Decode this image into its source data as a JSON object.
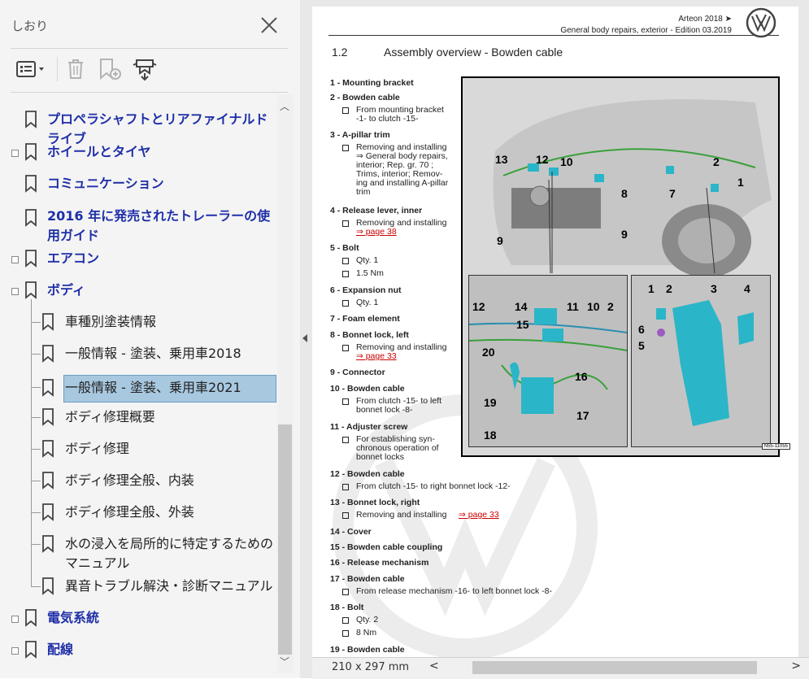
{
  "sidebar": {
    "title": "しおり",
    "toolbar": {
      "options_icon": "list-options-icon",
      "delete_icon": "trash-icon",
      "new_bookmark_icon": "new-bookmark-icon",
      "expand_icon": "expand-bookmark-icon"
    },
    "items": [
      {
        "label": "プロペラシャフトとリアファイナルドライブ"
      },
      {
        "label": "ホイールとタイヤ"
      },
      {
        "label": "コミュニケーション"
      },
      {
        "label": "2016 年に発売されたトレーラーの使用ガイド"
      },
      {
        "label": "エアコン"
      },
      {
        "label": "ボディ"
      },
      {
        "label": "車種別塗装情報"
      },
      {
        "label": "一般情報 - 塗装、乗用車2018"
      },
      {
        "label": "一般情報 - 塗装、乗用車2021"
      },
      {
        "label": "ボディ修理概要"
      },
      {
        "label": "ボディ修理"
      },
      {
        "label": "ボディ修理全般、内装"
      },
      {
        "label": "ボディ修理全般、外装"
      },
      {
        "label": "水の浸入を局所的に特定するためのマニュアル"
      },
      {
        "label": "異音トラブル解決・診断マニュアル"
      },
      {
        "label": "電気系統"
      },
      {
        "label": "配線"
      }
    ]
  },
  "document": {
    "header_model": "Arteon 2018 ➤",
    "header_edition": "General body repairs, exterior - Edition 03.2019",
    "section_number": "1.2",
    "section_title": "Assembly overview - Bowden cable",
    "entries": [
      {
        "title": "1 - Mounting bracket",
        "subs": []
      },
      {
        "title": "2 - Bowden cable",
        "subs": [
          "From mounting bracket",
          "-1- to clutch -15-"
        ]
      },
      {
        "title": "3 - A-pillar trim",
        "subs": [
          "Removing and installing",
          "⇒ General body repairs,",
          "interior; Rep. gr.  70 ;",
          "Trims, interior; Remov-",
          "ing and installing A-pillar",
          "trim"
        ]
      },
      {
        "title": "4 - Release lever, inner",
        "subs": [
          "Removing and installing"
        ],
        "link": "⇒ page 38"
      },
      {
        "title": "5 - Bolt",
        "subs": [
          "Qty. 1",
          "1.5 Nm"
        ]
      },
      {
        "title": "6 - Expansion nut",
        "subs": [
          "Qty. 1"
        ]
      },
      {
        "title": "7 - Foam element",
        "subs": []
      },
      {
        "title": "8 - Bonnet lock, left",
        "subs": [
          "Removing and installing"
        ],
        "link": "⇒ page 33"
      },
      {
        "title": "9 - Connector",
        "subs": []
      },
      {
        "title": "10 - Bowden cable",
        "subs": [
          "From clutch -15- to left",
          "bonnet lock -8-"
        ]
      },
      {
        "title": "11 - Adjuster screw",
        "subs": [
          "For establishing syn-",
          "chronous operation of",
          "bonnet locks"
        ]
      },
      {
        "title": "12 - Bowden cable",
        "subs": [
          "From clutch -15- to right bonnet lock -12-"
        ]
      },
      {
        "title": "13 - Bonnet lock, right",
        "subs": [
          "Removing and installing"
        ],
        "link": "⇒ page 33"
      },
      {
        "title": "14 - Cover",
        "subs": []
      },
      {
        "title": "15 - Bowden cable coupling",
        "subs": []
      },
      {
        "title": "16 - Release mechanism",
        "subs": []
      },
      {
        "title": "17 - Bowden cable",
        "subs": [
          "From release mechanism -16- to left bonnet lock -8-"
        ]
      },
      {
        "title": "18 - Bolt",
        "subs": [
          "Qty. 2",
          "8 Nm"
        ]
      },
      {
        "title": "19 - Bowden cable",
        "subs": []
      }
    ],
    "figure": {
      "callouts_main": [
        "13",
        "12",
        "10",
        "8",
        "2",
        "1",
        "7",
        "9",
        "9"
      ],
      "callouts_inset1": [
        "12",
        "14",
        "11",
        "10",
        "2",
        "15",
        "20",
        "16",
        "19",
        "17",
        "18"
      ],
      "callouts_inset2": [
        "1",
        "2",
        "3",
        "4",
        "6",
        "5"
      ],
      "figure_id": "N55-11055"
    }
  },
  "statusbar": {
    "page_size": "210 x 297 mm",
    "scroll_left": "<",
    "scroll_right": ">"
  },
  "colors": {
    "bookmark_blue": "#1f2fa8",
    "selection": "#a8c8e0",
    "link_red": "#cc0000"
  }
}
